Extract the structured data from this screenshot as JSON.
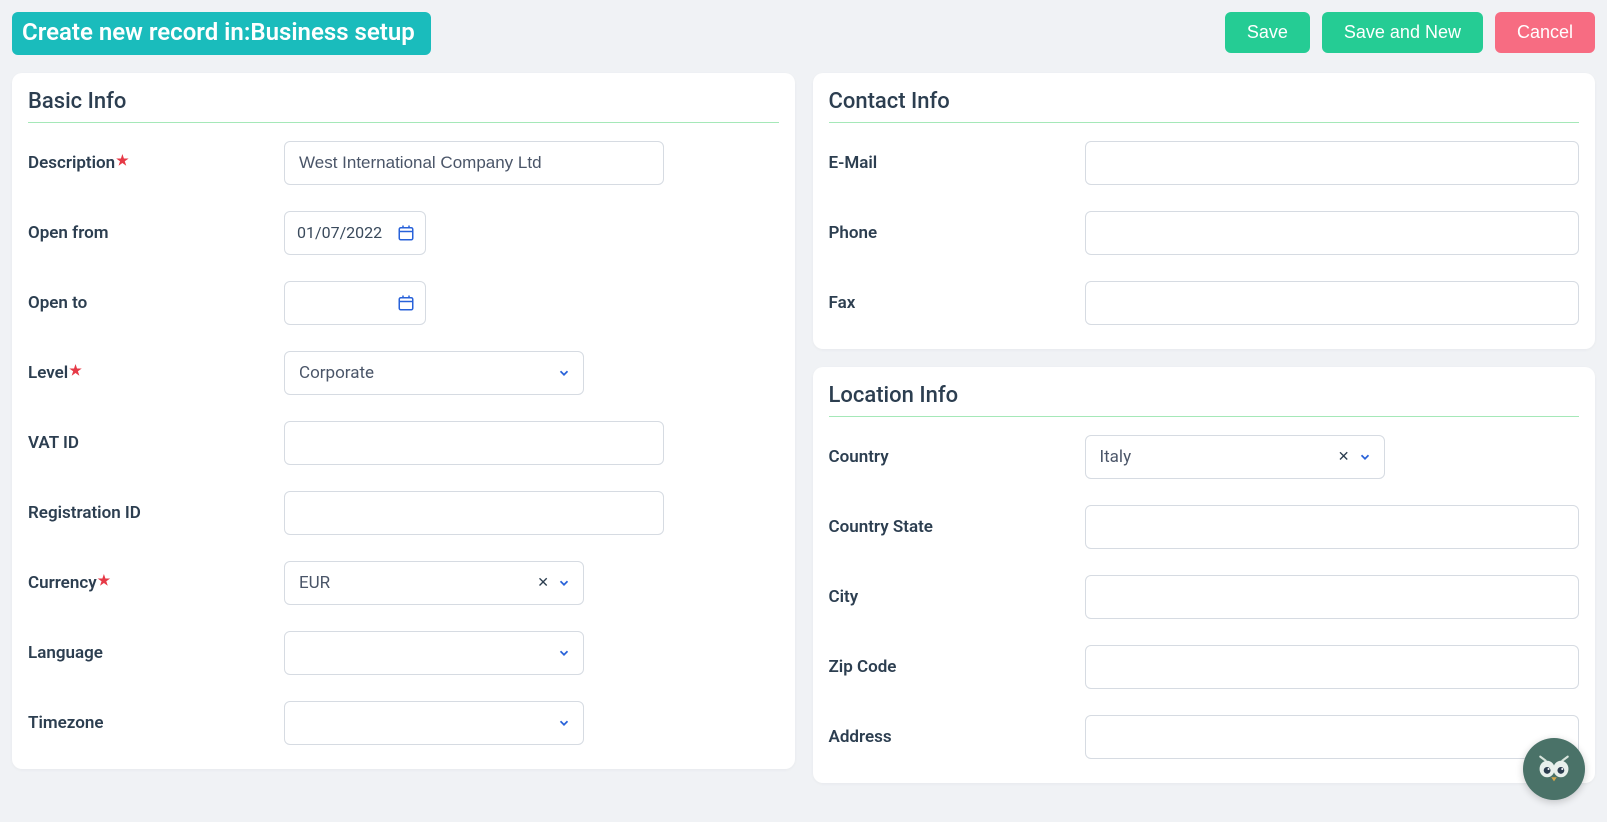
{
  "header": {
    "title": "Create new record in:Business setup",
    "buttons": {
      "save": "Save",
      "save_new": "Save and New",
      "cancel": "Cancel"
    }
  },
  "panels": {
    "basic": {
      "title": "Basic Info",
      "fields": {
        "description": {
          "label": "Description",
          "value": "West International Company Ltd",
          "required": true
        },
        "open_from": {
          "label": "Open from",
          "value": "01/07/2022"
        },
        "open_to": {
          "label": "Open to",
          "value": ""
        },
        "level": {
          "label": "Level",
          "value": "Corporate",
          "required": true
        },
        "vat_id": {
          "label": "VAT ID",
          "value": ""
        },
        "reg_id": {
          "label": "Registration ID",
          "value": ""
        },
        "currency": {
          "label": "Currency",
          "value": "EUR",
          "required": true
        },
        "language": {
          "label": "Language",
          "value": ""
        },
        "timezone": {
          "label": "Timezone",
          "value": ""
        }
      }
    },
    "contact": {
      "title": "Contact Info",
      "fields": {
        "email": {
          "label": "E-Mail",
          "value": ""
        },
        "phone": {
          "label": "Phone",
          "value": ""
        },
        "fax": {
          "label": "Fax",
          "value": ""
        }
      }
    },
    "location": {
      "title": "Location Info",
      "fields": {
        "country": {
          "label": "Country",
          "value": "Italy"
        },
        "country_state": {
          "label": "Country State",
          "value": ""
        },
        "city": {
          "label": "City",
          "value": ""
        },
        "zip": {
          "label": "Zip Code",
          "value": ""
        },
        "address": {
          "label": "Address",
          "value": ""
        }
      }
    }
  }
}
